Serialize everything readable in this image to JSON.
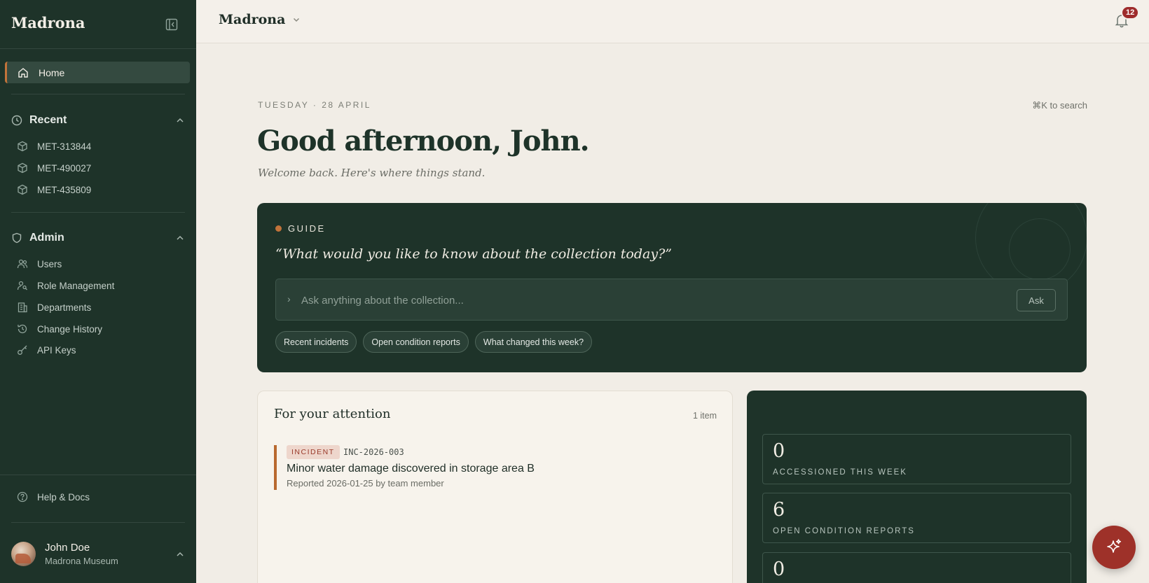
{
  "sidebar": {
    "brand": "Madrona",
    "home_label": "Home",
    "recent": {
      "heading": "Recent",
      "items": [
        {
          "label": "MET-313844"
        },
        {
          "label": "MET-490027"
        },
        {
          "label": "MET-435809"
        }
      ]
    },
    "admin": {
      "heading": "Admin",
      "items": [
        {
          "label": "Users",
          "icon": "users-icon"
        },
        {
          "label": "Role Management",
          "icon": "user-key-icon"
        },
        {
          "label": "Departments",
          "icon": "building-icon"
        },
        {
          "label": "Change History",
          "icon": "history-icon"
        },
        {
          "label": "API Keys",
          "icon": "key-icon"
        }
      ]
    },
    "help_label": "Help & Docs",
    "user": {
      "name": "John Doe",
      "org": "Madrona Museum"
    }
  },
  "header": {
    "workspace": "Madrona",
    "notification_count": "12"
  },
  "main": {
    "date": "TUESDAY · 28 APRIL",
    "search_hint": "⌘K to search",
    "greeting": "Good afternoon, John.",
    "welcome": "Welcome back. Here's where things stand.",
    "guide": {
      "label": "GUIDE",
      "question": "“What would you like to know about the collection today?”",
      "placeholder": "Ask anything about the collection...",
      "ask_label": "Ask",
      "suggestions": [
        "Recent incidents",
        "Open condition reports",
        "What changed this week?"
      ]
    },
    "attention": {
      "title": "For your attention",
      "count": "1 item",
      "incident": {
        "tag": "INCIDENT",
        "id": "INC-2026-003",
        "title": "Minor water damage discovered in storage area B",
        "meta": "Reported 2026-01-25 by team member"
      }
    },
    "stats": [
      {
        "value": "0",
        "label": "ACCESSIONED THIS WEEK"
      },
      {
        "value": "6",
        "label": "OPEN CONDITION REPORTS"
      },
      {
        "value": "0",
        "label": ""
      }
    ]
  },
  "colors": {
    "sidebar_bg": "#1e3329",
    "accent": "#c2733a",
    "badge": "#9e2c2c",
    "page_bg": "#f1ede6"
  }
}
